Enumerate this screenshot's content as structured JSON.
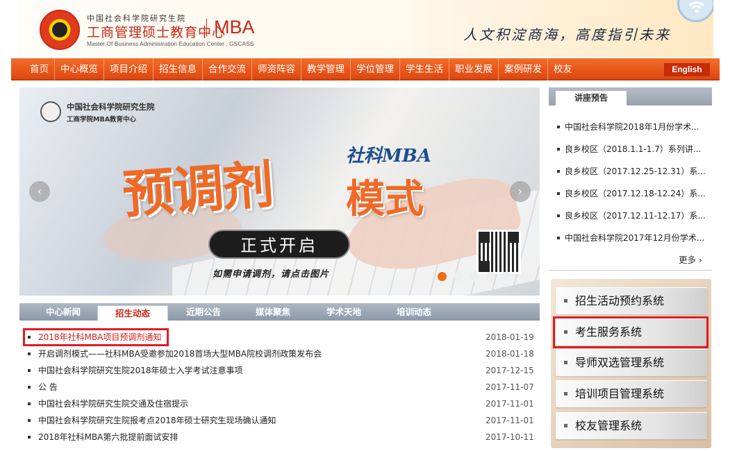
{
  "header": {
    "org_cn": "中国社会科学院研究生院",
    "org_title": "工商管理硕士教育中心",
    "org_mba": "MBA",
    "org_en": "Master Of Business Administration Education Center , GSCASS",
    "slogan": "人文积淀商海，高度指引未来"
  },
  "nav": {
    "items": [
      "首页",
      "中心概览",
      "项目介绍",
      "招生信息",
      "合作交流",
      "师资阵容",
      "教学管理",
      "学位管理",
      "学生生活",
      "职业发展",
      "案例研发",
      "校友"
    ],
    "english": "English"
  },
  "banner": {
    "school_cn": "中国社会科学院研究生院",
    "school_sub": "工商学院MBA教育中心",
    "shekemba": "社科MBA",
    "big": "预调剂",
    "mode": "模式",
    "start": "正式开启",
    "hint": "如需申请调剂，请点击图片",
    "prev": "‹",
    "next": "›"
  },
  "tabs": [
    "中心新闻",
    "招生动态",
    "近期公告",
    "媒体聚焦",
    "学术天地",
    "培训动态"
  ],
  "news": [
    {
      "title": "2018年社科MBA项目预调剂通知",
      "date": "2018-01-19"
    },
    {
      "title": "开启调剂模式——社科MBA受邀参加2018首场大型MBA院校调剂政策发布会",
      "date": "2018-01-18"
    },
    {
      "title": "中国社会科学院研究生院2018年硕士入学考试注意事项",
      "date": "2017-12-15"
    },
    {
      "title": "公  告",
      "date": "2017-11-07"
    },
    {
      "title": "中国社会科学院研究生院交通及住宿提示",
      "date": "2017-11-01"
    },
    {
      "title": "中国社会科学院研究生院报考点2018年硕士研究生现场确认通知",
      "date": "2017-11-01"
    },
    {
      "title": "2018年社科MBA第六批提前面试安排",
      "date": "2017-10-11"
    }
  ],
  "lectures": {
    "tab": "讲座预告",
    "items": [
      "中国社会科学院2018年1月份学术...",
      "良乡校区（2018.1.1-1.7）系列讲...",
      "良乡校区（2017.12.25-12.31）系...",
      "良乡校区（2017.12.18-12.24）系...",
      "良乡校区（2017.12.11-12.17）系...",
      "中国社会科学院2017年12月份学术..."
    ],
    "more": "更多 ›"
  },
  "systems": [
    "招生活动预约系统",
    "考生服务系统",
    "导师双选管理系统",
    "培训项目管理系统",
    "校友管理系统"
  ]
}
